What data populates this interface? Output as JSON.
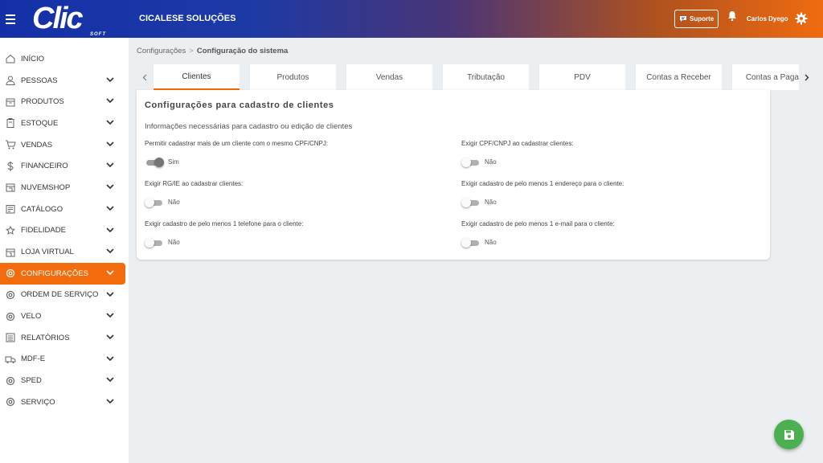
{
  "header": {
    "logo_text": "Clic",
    "logo_sub": "SOFT",
    "company": "CICALESE SOLUÇÕES",
    "support_label": "Suporte",
    "user_name": "Carlos Dyego"
  },
  "sidebar": {
    "items": [
      {
        "label": "INÍCIO",
        "icon": "home-icon",
        "has_chevron": false
      },
      {
        "label": "PESSOAS",
        "icon": "person-icon",
        "has_chevron": true
      },
      {
        "label": "PRODUTOS",
        "icon": "box-icon",
        "has_chevron": true
      },
      {
        "label": "ESTOQUE",
        "icon": "clipboard-icon",
        "has_chevron": true
      },
      {
        "label": "VENDAS",
        "icon": "cart-icon",
        "has_chevron": true
      },
      {
        "label": "FINANCEIRO",
        "icon": "dollar-icon",
        "has_chevron": true
      },
      {
        "label": "NUVEMSHOP",
        "icon": "store-icon",
        "has_chevron": true
      },
      {
        "label": "CATÁLOGO",
        "icon": "catalog-icon",
        "has_chevron": true
      },
      {
        "label": "FIDELIDADE",
        "icon": "loyalty-icon",
        "has_chevron": true
      },
      {
        "label": "LOJA VIRTUAL",
        "icon": "shop-icon",
        "has_chevron": true
      },
      {
        "label": "CONFIGURAÇÕES",
        "icon": "settings-icon",
        "has_chevron": true,
        "active": true
      },
      {
        "label": "ORDEM DE SERVIÇO",
        "icon": "service-order-icon",
        "has_chevron": true
      },
      {
        "label": "VELO",
        "icon": "velo-icon",
        "has_chevron": true
      },
      {
        "label": "RELATÓRIOS",
        "icon": "report-icon",
        "has_chevron": true
      },
      {
        "label": "MDF-E",
        "icon": "truck-icon",
        "has_chevron": true
      },
      {
        "label": "SPED",
        "icon": "sped-icon",
        "has_chevron": true
      },
      {
        "label": "SERVIÇO",
        "icon": "service-icon",
        "has_chevron": true
      }
    ]
  },
  "breadcrumb": {
    "parent": "Configurações",
    "separator": ">",
    "current": "Configuração do sistema"
  },
  "tabs": [
    {
      "label": "Clientes",
      "active": true
    },
    {
      "label": "Produtos"
    },
    {
      "label": "Vendas"
    },
    {
      "label": "Tributação"
    },
    {
      "label": "PDV"
    },
    {
      "label": "Contas a Receber"
    },
    {
      "label": "Contas a Paga"
    }
  ],
  "card": {
    "title": "Configurações para cadastro de clientes",
    "subtitle": "Informações necessárias para cadastro ou edição de clientes",
    "fields": [
      {
        "label": "Permitir cadastrar mais de um cliente com o mesmo CPF/CNPJ:",
        "value": "Sim",
        "on": true
      },
      {
        "label": "Exigir CPF/CNPJ ao cadastrar clientes:",
        "value": "Não",
        "on": false
      },
      {
        "label": "Exigir RG/IE ao cadastrar clientes:",
        "value": "Não",
        "on": false
      },
      {
        "label": "Exigir cadastro de pelo menos 1 endereço para o cliente:",
        "value": "Não",
        "on": false
      },
      {
        "label": "Exigir cadastro de pelo menos 1 telefone para o cliente:",
        "value": "Não",
        "on": false
      },
      {
        "label": "Exigir cadastro de pelo menos 1 e-mail para o cliente:",
        "value": "Não",
        "on": false
      }
    ]
  },
  "colors": {
    "accent": "#f26c0d",
    "header_start": "#1430a8",
    "header_end": "#f06b10",
    "save_button": "#4caf50"
  }
}
